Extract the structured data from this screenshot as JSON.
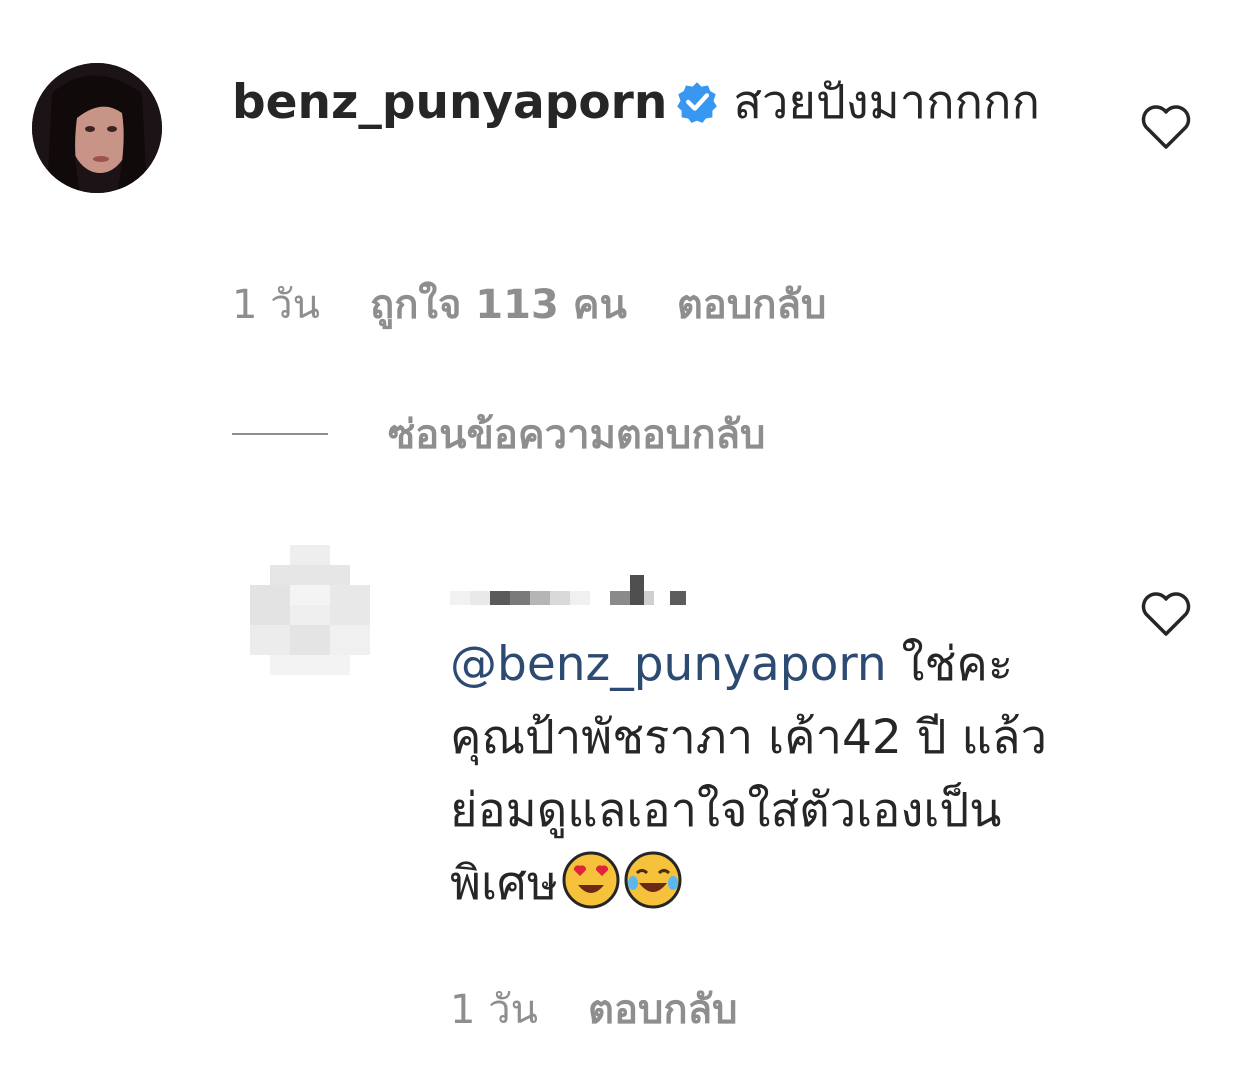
{
  "comment": {
    "username": "benz_punyaporn",
    "verified_icon": "verified-badge-icon",
    "text": "สวยปังมากกกก",
    "time": "1 วัน",
    "likes": "ถูกใจ 113 คน",
    "reply_label": "ตอบกลับ",
    "like_icon": "heart-outline-icon"
  },
  "toggle_replies": {
    "label": "ซ่อนข้อความตอบกลับ"
  },
  "reply": {
    "mention": "@benz_punyaporn",
    "text": " ใช่คะ คุณป้าพัชราภา เค้า42 ปี แล้วย่อมดูแลเอาใจใส่ตัวเองเป็น พิเศษ",
    "emojis": [
      "heart-eyes-emoji",
      "tears-of-joy-emoji"
    ],
    "time": "1 วัน",
    "reply_label": "ตอบกลับ",
    "like_icon": "heart-outline-icon"
  },
  "colors": {
    "text": "#262626",
    "secondary": "#8e8e8e",
    "mention": "#2c4a72",
    "verified": "#3897f0"
  }
}
